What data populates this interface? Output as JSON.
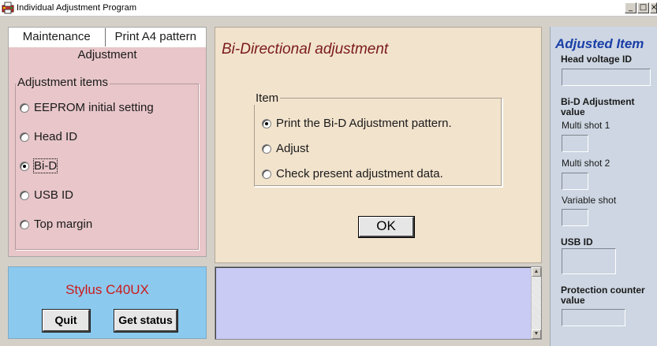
{
  "window": {
    "title": "Individual Adjustment Program",
    "controls": {
      "minimize": "_",
      "maximize": "□",
      "close": "×"
    }
  },
  "left_panel": {
    "tabs": [
      {
        "label": "Maintenance",
        "active": false
      },
      {
        "label": "Print A4 pattern",
        "active": false
      },
      {
        "label": "Adjustment",
        "active": true
      }
    ],
    "group_label": "Adjustment items",
    "options": [
      {
        "label": "EEPROM initial setting",
        "checked": false
      },
      {
        "label": "Head ID",
        "checked": false
      },
      {
        "label": "Bi-D",
        "checked": true
      },
      {
        "label": "USB ID",
        "checked": false
      },
      {
        "label": "Top margin",
        "checked": false
      }
    ]
  },
  "center_panel": {
    "title": "Bi-Directional adjustment",
    "group_label": "Item",
    "options": [
      {
        "label": "Print the Bi-D Adjustment pattern.",
        "checked": true
      },
      {
        "label": "Adjust",
        "checked": false
      },
      {
        "label": "Check present adjustment data.",
        "checked": false
      }
    ],
    "ok_label": "OK"
  },
  "status_panel": {
    "model": "Stylus C40UX",
    "quit_label": "Quit",
    "status_label": "Get status"
  },
  "log": {
    "value": ""
  },
  "right_panel": {
    "title": "Adjusted Item",
    "head_voltage_label": "Head voltage ID",
    "bid_label": "Bi-D Adjustment value",
    "multi1_label": "Multi shot 1",
    "multi2_label": "Multi shot 2",
    "variable_label": "Variable shot",
    "usb_label": "USB ID",
    "protection_label": "Protection counter value"
  },
  "colors": {
    "left_bg": "#e8c6c9",
    "center_bg": "#f2e3cd",
    "status_bg": "#8cc9ee",
    "log_bg": "#c9cbf5",
    "right_bg": "#cdd6e2",
    "model_text": "#cc1a1a",
    "center_title_text": "#7a1a1a",
    "right_title_text": "#1a3fa8"
  },
  "icons": {
    "app": "printer-app-icon"
  }
}
